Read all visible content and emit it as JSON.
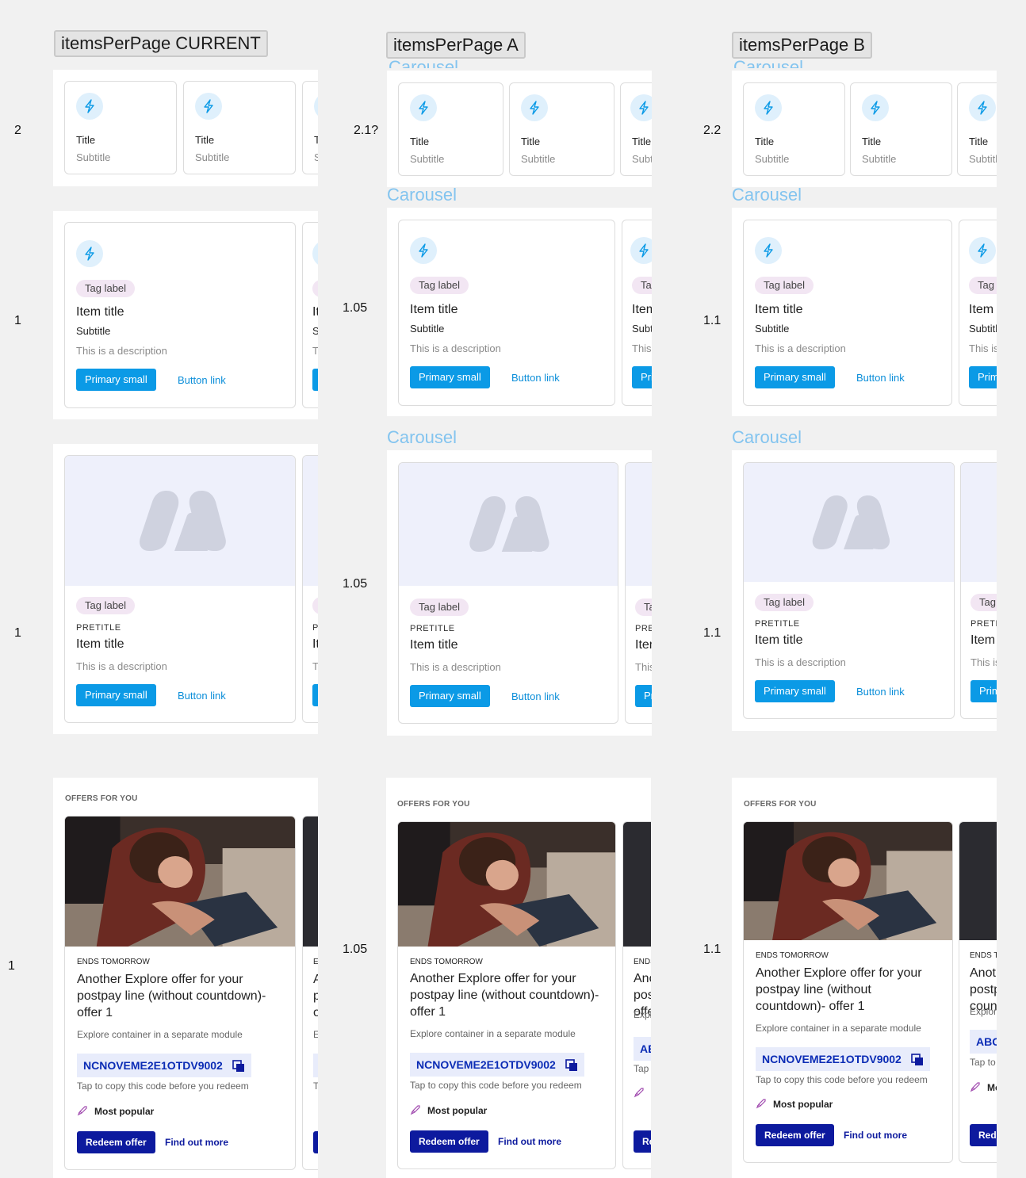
{
  "columns": [
    {
      "header": "itemsPerPage CURRENT",
      "ratios": [
        "2",
        "1",
        "1",
        "1"
      ]
    },
    {
      "header": "itemsPerPage A",
      "ratios": [
        "2.1?",
        "1.05",
        "1.05",
        "1.05"
      ]
    },
    {
      "header": "itemsPerPage B",
      "ratios": [
        "2.2",
        "1.1",
        "1.1",
        "1.1"
      ]
    }
  ],
  "carousel_label": "Carousel",
  "small_card": {
    "title": "Title",
    "subtitle": "Subtitle",
    "icon": "lightning-icon"
  },
  "item_card": {
    "tag": "Tag label",
    "title": "Item title",
    "subtitle": "Subtitle",
    "description": "This is a description",
    "primary": "Primary small",
    "link": "Button link"
  },
  "media_card": {
    "tag": "Tag label",
    "pretitle": "PRETITLE",
    "title": "Item title",
    "description": "This is a description",
    "primary": "Primary small",
    "link": "Button link",
    "image_icon": "placeholder-logo-icon"
  },
  "offer": {
    "heading": "OFFERS FOR YOU",
    "ends": "ENDS TOMORROW",
    "title": "Another Explore offer for your postpay line (without countdown)- offer 1",
    "description": "Explore container in a separate module",
    "code": "NCNOVEME2E1OTDV9002",
    "code_hint": "Tap to copy this code before you redeem",
    "popular": "Most popular",
    "redeem": "Redeem offer",
    "find_more": "Find out more",
    "peek_ends": "ENDS T",
    "peek_code": "ABC",
    "peek_desc": "Explor",
    "peek_hint": "Tap to"
  },
  "colors": {
    "accent": "#0b9ae6",
    "offer_primary": "#0d1a9e",
    "carousel_label": "#83c4ef",
    "tag_bg": "#f2e6f3"
  }
}
